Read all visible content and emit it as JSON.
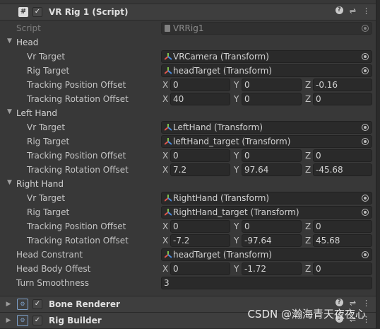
{
  "component": {
    "title": "VR Rig 1 (Script)",
    "script_label": "Script",
    "script_value": "VRRig1"
  },
  "groups": [
    {
      "label": "Head",
      "vr_target_label": "Vr Target",
      "vr_target": "VRCamera (Transform)",
      "rig_target_label": "Rig Target",
      "rig_target": "headTarget (Transform)",
      "pos_label": "Tracking Position Offset",
      "pos": {
        "x": "0",
        "y": "0",
        "z": "-0.16"
      },
      "rot_label": "Tracking Rotation Offset",
      "rot": {
        "x": "40",
        "y": "0",
        "z": "0"
      }
    },
    {
      "label": "Left Hand",
      "vr_target_label": "Vr Target",
      "vr_target": "LeftHand (Transform)",
      "rig_target_label": "Rig Target",
      "rig_target": "leftHand_target (Transform)",
      "pos_label": "Tracking Position Offset",
      "pos": {
        "x": "0",
        "y": "0",
        "z": "0"
      },
      "rot_label": "Tracking Rotation Offset",
      "rot": {
        "x": "7.2",
        "y": "97.64",
        "z": "-45.68"
      }
    },
    {
      "label": "Right Hand",
      "vr_target_label": "Vr Target",
      "vr_target": "RightHand (Transform)",
      "rig_target_label": "Rig Target",
      "rig_target": "RightHand_target (Transform)",
      "pos_label": "Tracking Position Offset",
      "pos": {
        "x": "0",
        "y": "0",
        "z": "0"
      },
      "rot_label": "Tracking Rotation Offset",
      "rot": {
        "x": "-7.2",
        "y": "-97.64",
        "z": "45.68"
      }
    }
  ],
  "head_constrant": {
    "label": "Head Constrant",
    "value": "headTarget (Transform)"
  },
  "head_body_offset": {
    "label": "Head Body Offest",
    "x": "0",
    "y": "-1.72",
    "z": "0"
  },
  "turn_smoothness": {
    "label": "Turn Smoothness",
    "value": "3"
  },
  "axes": {
    "x": "X",
    "y": "Y",
    "z": "Z"
  },
  "other_components": [
    {
      "title": "Bone Renderer"
    },
    {
      "title": "Rig Builder"
    }
  ],
  "watermark": "CSDN @瀚海青天夜夜心",
  "icons": {
    "script": "script-icon",
    "checkbox": "checkbox-checked-icon",
    "help": "help-icon",
    "preset": "preset-sliders-icon",
    "menu": "kebab-menu-icon",
    "picker": "object-picker-icon",
    "transform": "transform-icon",
    "foldout": "foldout-arrow-icon"
  },
  "colors": {
    "background": "#383838",
    "field": "#2a2a2a",
    "header": "#3e3e3e",
    "text": "#c4c4c4"
  }
}
